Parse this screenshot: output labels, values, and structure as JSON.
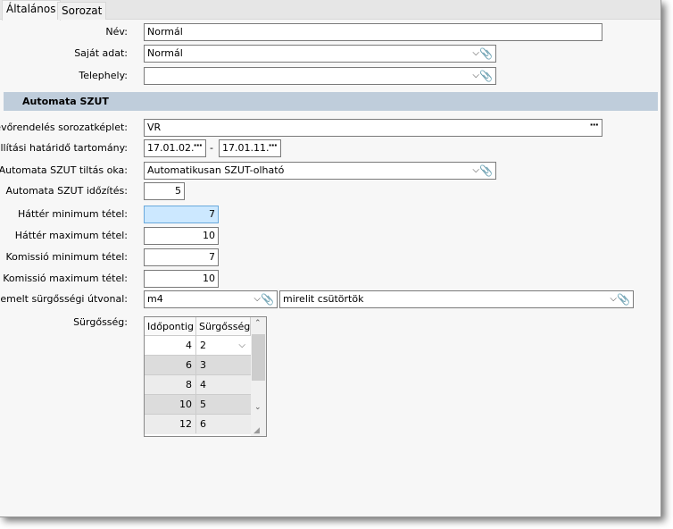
{
  "tabs": [
    {
      "label": "Általános",
      "active": true
    },
    {
      "label": "Sorozat",
      "active": false
    }
  ],
  "fields": {
    "nev": {
      "label": "Név:",
      "value": "Normál"
    },
    "sajat": {
      "label": "Saját adat:",
      "value": "Normál"
    },
    "telephely": {
      "label": "Telephely:",
      "value": ""
    }
  },
  "section": {
    "title": "Automata SZUT"
  },
  "szut": {
    "keplet": {
      "label": "Vevőrendelés sorozatképlet:",
      "value": "VR"
    },
    "hatarido": {
      "label": "Szállítási határidő tartomány:",
      "from": "17.01.02.",
      "sep": "-",
      "to": "17.01.11."
    },
    "tiltas": {
      "label": "Automata SZUT tiltás oka:",
      "value": "Automatikusan SZUT-olható"
    },
    "idozites": {
      "label": "Automata SZUT időzítés:",
      "value": "5"
    },
    "hatter_min": {
      "label": "Háttér minimum tétel:",
      "value": "7"
    },
    "hatter_max": {
      "label": "Háttér maximum tétel:",
      "value": "10"
    },
    "kom_min": {
      "label": "Komissió minimum tétel:",
      "value": "7"
    },
    "kom_max": {
      "label": "Komissió maximum tétel:",
      "value": "10"
    },
    "utvonal": {
      "label": "Kiemelt sürgősségi útvonal:",
      "value": "m4",
      "value2": "mirelit csütörtök"
    },
    "surgosseg": {
      "label": "Sürgősség:",
      "headers": [
        "Időpontig",
        "Sürgősség"
      ],
      "rows": [
        [
          "4",
          "2"
        ],
        [
          "6",
          "3"
        ],
        [
          "8",
          "4"
        ],
        [
          "10",
          "5"
        ],
        [
          "12",
          "6"
        ]
      ]
    }
  },
  "colors": {
    "section": "#bfcddb",
    "focus": "#cce8ff"
  }
}
